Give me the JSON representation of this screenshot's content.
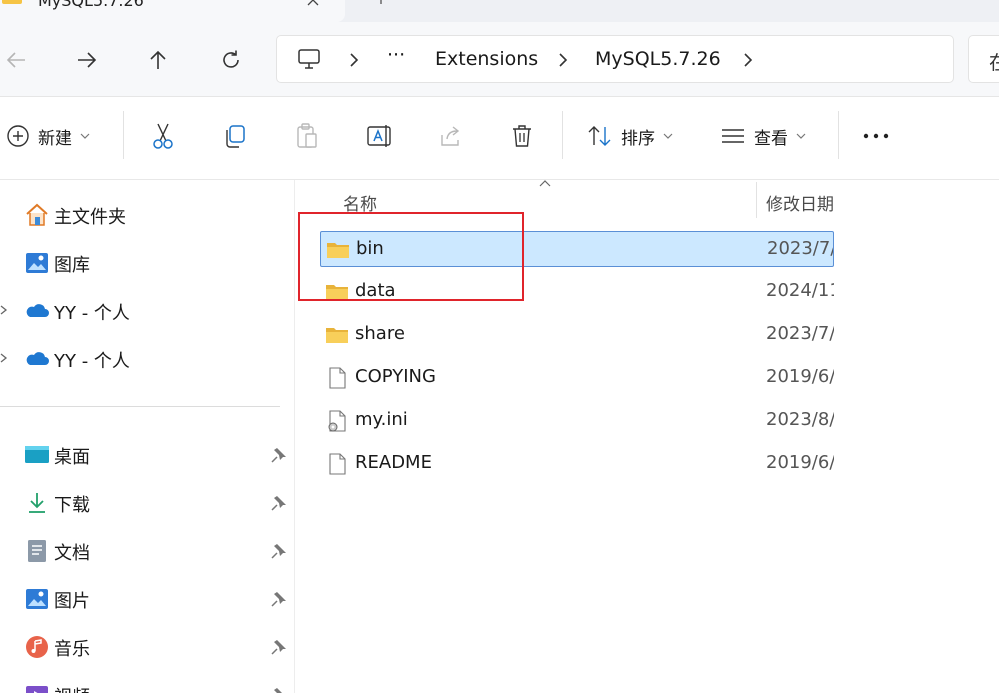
{
  "window": {
    "tab_title": "MySQL5.7.26"
  },
  "address": {
    "ellipsis": "···",
    "segments": [
      "Extensions",
      "MySQL5.7.26"
    ],
    "search_char": "在"
  },
  "toolbar": {
    "new_label": "新建",
    "sort_label": "排序",
    "view_label": "查看",
    "more_label": "···"
  },
  "sidebar": {
    "items": [
      {
        "label": "主文件夹",
        "icon": "home-icon"
      },
      {
        "label": "图库",
        "icon": "gallery-icon"
      },
      {
        "label": "YY - 个人",
        "icon": "onedrive-icon"
      },
      {
        "label": "YY - 个人",
        "icon": "onedrive-icon"
      }
    ],
    "quick_access": [
      {
        "label": "桌面",
        "icon": "desktop-icon"
      },
      {
        "label": "下载",
        "icon": "download-icon"
      },
      {
        "label": "文档",
        "icon": "documents-icon"
      },
      {
        "label": "图片",
        "icon": "pictures-icon"
      },
      {
        "label": "音乐",
        "icon": "music-icon"
      },
      {
        "label": "视频",
        "icon": "videos-icon"
      }
    ]
  },
  "list": {
    "col_name": "名称",
    "col_date": "修改日期",
    "rows": [
      {
        "name": "bin",
        "date": "2023/7/",
        "type": "folder",
        "selected": true
      },
      {
        "name": "data",
        "date": "2024/11",
        "type": "folder",
        "selected": false
      },
      {
        "name": "share",
        "date": "2023/7/",
        "type": "folder",
        "selected": false
      },
      {
        "name": "COPYING",
        "date": "2019/6/",
        "type": "file",
        "selected": false
      },
      {
        "name": "my.ini",
        "date": "2023/8/",
        "type": "settings-file",
        "selected": false
      },
      {
        "name": "README",
        "date": "2019/6/",
        "type": "file",
        "selected": false
      }
    ]
  },
  "colors": {
    "selection": "#cce8ff",
    "selection_border": "#5a8fd6",
    "annotation": "#e0242b",
    "folder": "#f6c445"
  }
}
